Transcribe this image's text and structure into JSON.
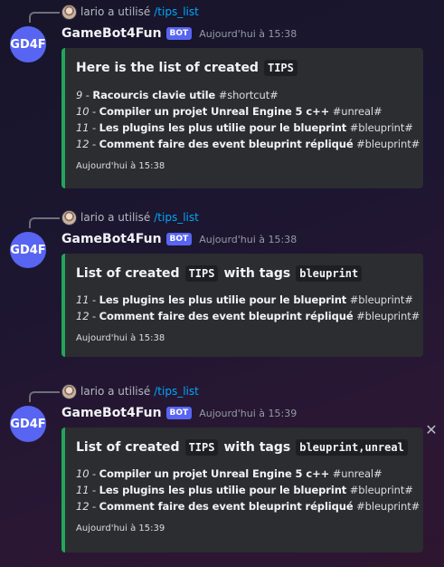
{
  "messages": [
    {
      "reply": {
        "user": "lario",
        "action": "a utilisé",
        "command": "/tips_list"
      },
      "bot": {
        "name": "GameBot4Fun",
        "tag": "BOT",
        "avatar_text": "GD4F"
      },
      "timestamp": "Aujourd'hui à 15:38",
      "embed": {
        "title_pre": "Here is the list of created",
        "title_code": "TIPS",
        "title_mid": "",
        "title_code2": "",
        "tips": [
          {
            "num": "9",
            "name": "Racourcis clavie utile",
            "tag": "#shortcut#"
          },
          {
            "num": "10",
            "name": "Compiler un projet Unreal Engine 5 c++",
            "tag": "#unreal#"
          },
          {
            "num": "11",
            "name": "Les plugins les plus utilie pour le blueprint",
            "tag": "#bleuprint#"
          },
          {
            "num": "12",
            "name": "Comment faire des event bleuprint répliqué",
            "tag": "#bleuprint#"
          }
        ],
        "footer": "Aujourd'hui à 15:38",
        "accent": "#23a55a"
      }
    },
    {
      "reply": {
        "user": "lario",
        "action": "a utilisé",
        "command": "/tips_list"
      },
      "bot": {
        "name": "GameBot4Fun",
        "tag": "BOT",
        "avatar_text": "GD4F"
      },
      "timestamp": "Aujourd'hui à 15:38",
      "embed": {
        "title_pre": "List of created",
        "title_code": "TIPS",
        "title_mid": "with tags",
        "title_code2": "bleuprint",
        "tips": [
          {
            "num": "11",
            "name": "Les plugins les plus utilie pour le blueprint",
            "tag": "#bleuprint#"
          },
          {
            "num": "12",
            "name": "Comment faire des event bleuprint répliqué",
            "tag": "#bleuprint#"
          }
        ],
        "footer": "Aujourd'hui à 15:38",
        "accent": "#23a55a"
      }
    },
    {
      "reply": {
        "user": "lario",
        "action": "a utilisé",
        "command": "/tips_list"
      },
      "bot": {
        "name": "GameBot4Fun",
        "tag": "BOT",
        "avatar_text": "GD4F"
      },
      "timestamp": "Aujourd'hui à 15:39",
      "embed": {
        "title_pre": "List of created",
        "title_code": "TIPS",
        "title_mid": "with tags",
        "title_code2": "bleuprint,unreal",
        "tips": [
          {
            "num": "10",
            "name": "Compiler un projet Unreal Engine 5 c++",
            "tag": "#unreal#"
          },
          {
            "num": "11",
            "name": "Les plugins les plus utilie pour le blueprint",
            "tag": "#bleuprint#"
          },
          {
            "num": "12",
            "name": "Comment faire des event bleuprint répliqué",
            "tag": "#bleuprint#"
          }
        ],
        "footer": "Aujourd'hui à 15:39",
        "accent": "#23a55a"
      }
    }
  ],
  "icons": {
    "close": "close-icon",
    "close_glyph": "✕"
  },
  "separator": " - "
}
